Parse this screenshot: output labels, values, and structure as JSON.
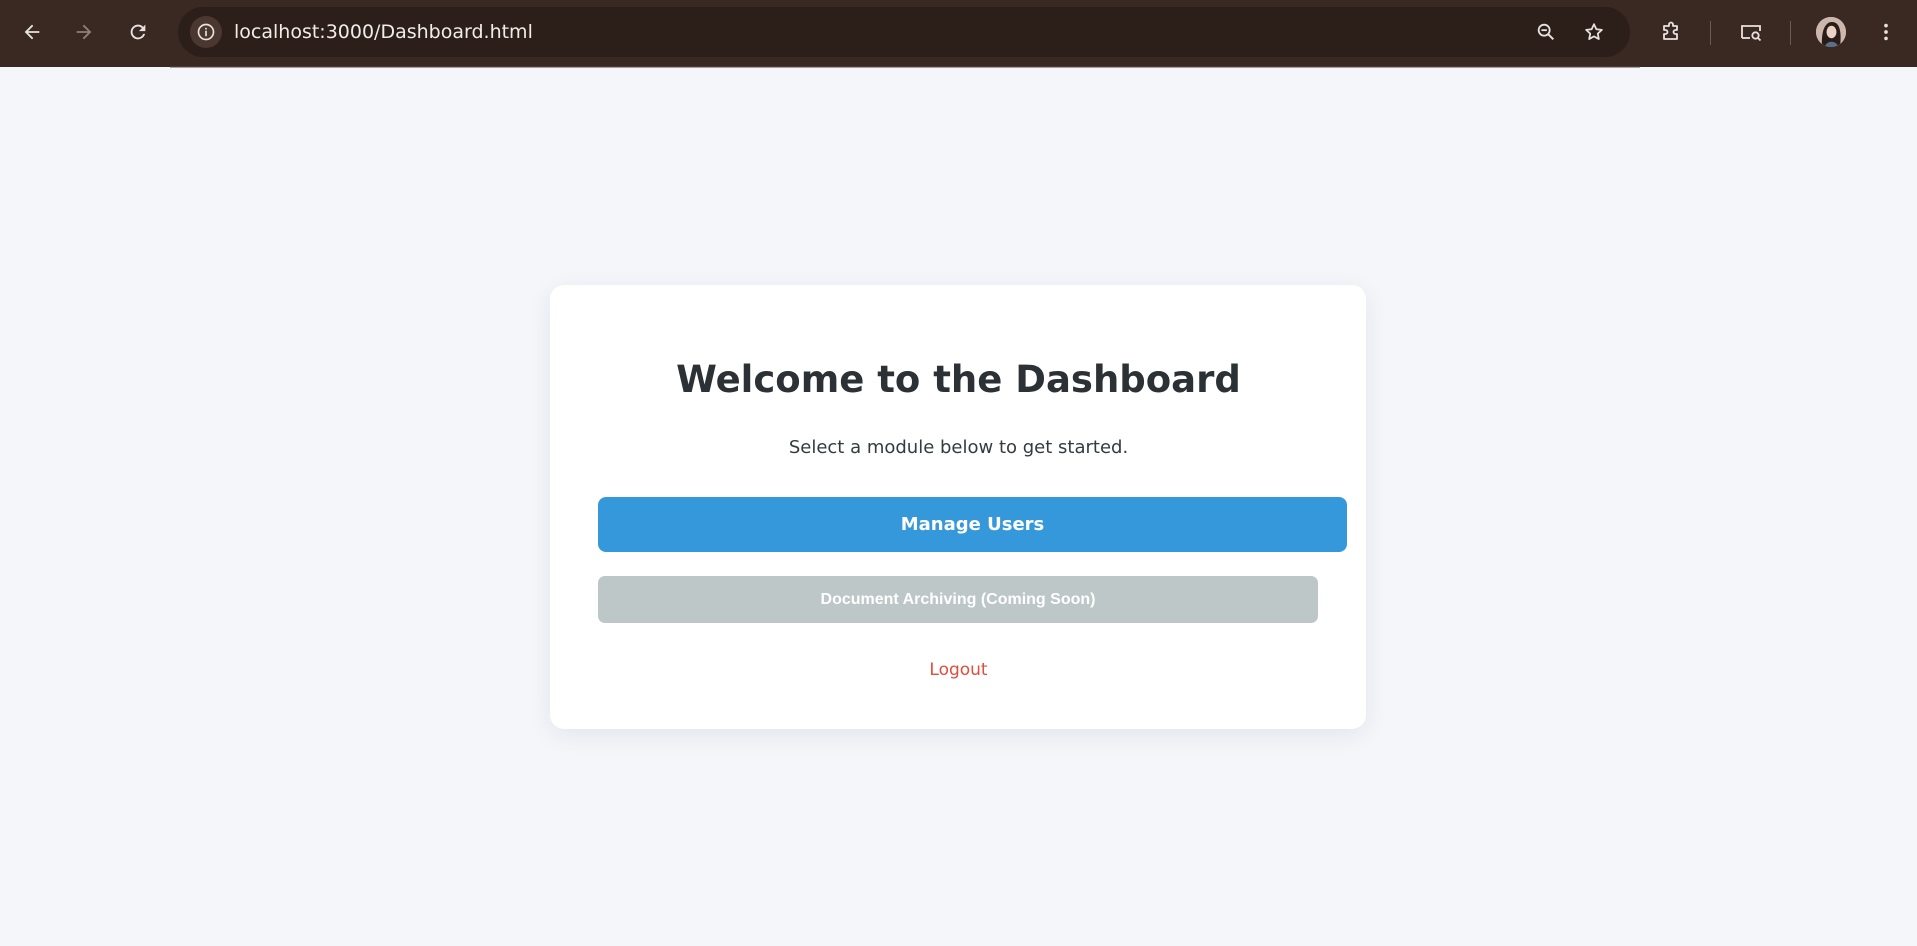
{
  "browser": {
    "url": "localhost:3000/Dashboard.html",
    "icons": {
      "back": "arrow-left-icon",
      "forward": "arrow-right-icon",
      "reload": "reload-icon",
      "site_info": "info-icon",
      "zoom": "zoom-out-icon",
      "bookmark": "star-icon",
      "extensions": "puzzle-icon",
      "media": "cast-search-icon",
      "menu": "kebab-menu-icon"
    },
    "colors": {
      "toolbar": "#3a2822",
      "omnibox": "#2c1f19"
    }
  },
  "page": {
    "title": "Welcome to the Dashboard",
    "subtitle": "Select a module below to get started.",
    "manage_users_label": "Manage Users",
    "archiving_label": "Document Archiving (Coming Soon)",
    "logout_label": "Logout",
    "colors": {
      "background": "#f4f6fa",
      "primary": "#3598db",
      "disabled": "#bdc7c8",
      "logout": "#e24c3c"
    }
  }
}
